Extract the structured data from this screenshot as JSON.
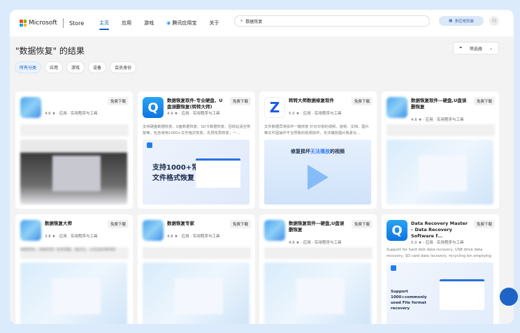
{
  "header": {
    "brand": "Microsoft",
    "store": "Store",
    "nav": [
      "主页",
      "应用",
      "游戏",
      "腾讯应用宝",
      "关于"
    ],
    "search_value": "数据恢复",
    "multi_install": "多应用安装"
  },
  "page": {
    "title": "\"数据恢复\" 的结果",
    "filter_label": "筛选器",
    "chips": [
      "所有分类",
      "应用",
      "游戏",
      "设备",
      "会员身份"
    ]
  },
  "colors": {
    "accent": "#0f5fbf",
    "background": "#dcebfb"
  },
  "cards": [
    {
      "name": "",
      "rating": "4.6 ★",
      "type": "应用",
      "category": "实用程序与工具",
      "price": "免费下载",
      "desc": ""
    },
    {
      "name": "数据恢复软件-专业硬盘、U盘误删恢复(转转大师)",
      "rating": "4.9 ★",
      "type": "应用",
      "category": "实用程序与工具",
      "price": "免费下载",
      "desc": "支持硬盘数据恢复、U盘数据恢复、SD卡数据恢复、回收站清空恢复等，包含常用1000+文件格式恢复，先预览再恢复，一...",
      "shot_title": "支持1000+常用",
      "shot_title_hl": "1000+",
      "shot_sub": "文件格式恢复"
    },
    {
      "name": "转转大师数据修复软件",
      "rating": "5.0 ★",
      "type": "应用",
      "category": "实用程序与工具",
      "price": "免费下载",
      "desc": "文件数据异常损坏一键修复 针对日常的视频、音频、文档、图片等文件因操作不当导致的视频损坏、无法播放图片像素化...",
      "shot_title_a": "修复损坏",
      "shot_title_hl": "无法播放",
      "shot_title_b": "的视频"
    },
    {
      "name": "数据恢复软件—硬盘,U盘误删恢复",
      "rating": "4.6 ★",
      "type": "应用",
      "category": "实用程序与工具",
      "price": "免费下载",
      "desc": ""
    },
    {
      "name": "数据恢复大师",
      "rating": "3.8 ★",
      "type": "应用",
      "category": "实用程序与工具",
      "price": "免费下载",
      "desc": "免费预览、深度恢复! 支持误删、格式化、分区丢失等场景"
    },
    {
      "name": "数据恢复专家",
      "rating": "4.8 ★",
      "type": "应用",
      "category": "实用程序与工具",
      "price": "免费下载",
      "desc": ""
    },
    {
      "name": "数据恢复软件—硬盘,U盘误删恢复",
      "rating": "4.6 ★",
      "type": "应用",
      "category": "实用程序与工具",
      "price": "免费下载",
      "desc": ""
    },
    {
      "name": "Data Recovery Master – Data Recovery Software f...",
      "rating": "5.0 ★",
      "type": "应用",
      "category": "实用程序与工具",
      "price": "免费下载",
      "desc": "Support for hard disk data recovery, USB drive data recovery, SD card data recovery, recycling bin emptying recovery, etc.,...",
      "shot_title": "Support 1000+commonly used File format recovery"
    }
  ]
}
